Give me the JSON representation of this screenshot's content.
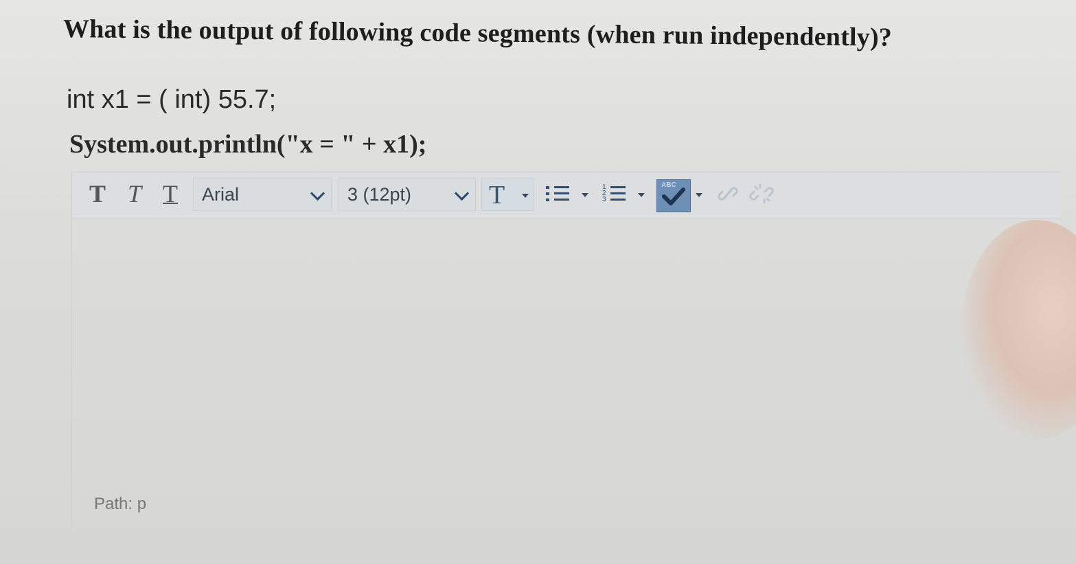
{
  "question": "What is the output of following code segments (when run independently)?",
  "code": {
    "line1": "int x1 = ( int) 55.7;",
    "line2": "System.out.println(\"x = \" + x1);"
  },
  "toolbar": {
    "bold_label": "T",
    "italic_label": "T",
    "underline_label": "T",
    "font_family_value": "Arial",
    "font_size_value": "3 (12pt)",
    "text_color_label": "T",
    "spellcheck_label": "ABC"
  },
  "icons": {
    "bold": "bold-icon",
    "italic": "italic-icon",
    "underline": "underline-icon",
    "text_color": "text-color-icon",
    "bullet_list": "bullet-list-icon",
    "numbered_list": "numbered-list-icon",
    "spellcheck": "spellcheck-icon",
    "link": "link-icon",
    "unlink": "unlink-icon"
  },
  "colors": {
    "spellcheck_active": "#6e8fb5",
    "toolbar_icon": "#2f4f76"
  },
  "editor": {
    "content": "",
    "path_label": "Path: p"
  }
}
